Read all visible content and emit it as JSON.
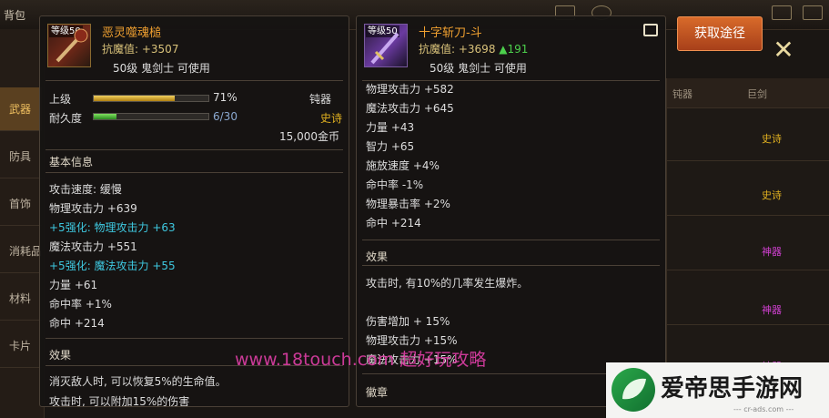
{
  "background": {
    "top_left_label": "背包",
    "side_tabs": [
      "武器",
      "防具",
      "首饰",
      "消耗品",
      "材料",
      "卡片"
    ],
    "table_headers": [
      "钝器",
      "巨剑"
    ],
    "table_tags": [
      {
        "label": "史诗",
        "color": "#e0b020"
      },
      {
        "label": "史诗",
        "color": "#e0b020"
      },
      {
        "label": "神器",
        "color": "#d040d0"
      },
      {
        "label": "神器",
        "color": "#d040d0"
      },
      {
        "label": "神器",
        "color": "#d040d0"
      }
    ]
  },
  "gain_button": "获取途径",
  "left_item": {
    "level_badge": "等级50",
    "name": "恶灵噬魂槌",
    "resist": "抗魔值: +3507",
    "requirement": "50级 鬼剑士 可使用",
    "grade_label": "上级",
    "grade_percent": "71%",
    "grade_fill": 0.71,
    "weapon_type": "钝器",
    "durability_label": "耐久度",
    "durability_value": "6/30",
    "durability_fill": 0.2,
    "rarity": "史诗",
    "price": "15,000金币",
    "basic_title": "基本信息",
    "stats": [
      {
        "text": "攻击速度: 缓慢",
        "color": "#dddddd"
      },
      {
        "text": "物理攻击力 +639",
        "color": "#dddddd"
      },
      {
        "text": "+5强化: 物理攻击力 +63",
        "color": "#3ec8e0"
      },
      {
        "text": "魔法攻击力 +551",
        "color": "#dddddd"
      },
      {
        "text": "+5强化: 魔法攻击力 +55",
        "color": "#3ec8e0"
      },
      {
        "text": "力量 +61",
        "color": "#dddddd"
      },
      {
        "text": "命中率 +1%",
        "color": "#dddddd"
      },
      {
        "text": "命中 +214",
        "color": "#dddddd"
      }
    ],
    "effect_title": "效果",
    "effects": [
      "消灭敌人时, 可以恢复5%的生命值。",
      "攻击时, 可以附加15%的伤害"
    ]
  },
  "right_item": {
    "level_badge": "等级50",
    "name": "十字斩刀-斗",
    "resist_prefix": "抗魔值: +3698",
    "resist_up": "▲191",
    "requirement": "50级 鬼剑士 可使用",
    "stats": [
      "物理攻击力 +582",
      "魔法攻击力 +645",
      "力量 +43",
      "智力 +65",
      "施放速度 +4%",
      "命中率 -1%",
      "物理暴击率 +2%",
      "命中 +214"
    ],
    "effect_title": "效果",
    "effect_line": "攻击时, 有10%的几率发生爆炸。",
    "extra": [
      "伤害增加 + 15%",
      "物理攻击力 +15%",
      "魔法攻击力 +15%"
    ],
    "emblem_title": "徽章"
  },
  "watermark": "www.18touch.com 超好玩攻略",
  "logo": {
    "title": "爱帝思手游网",
    "subtitle": "--- cr-ads.com ---"
  },
  "colors": {
    "orange_name": "#f0a030",
    "epic": "#e0b020",
    "cyan": "#3ec8e0",
    "green_up": "#4ccf4c"
  }
}
